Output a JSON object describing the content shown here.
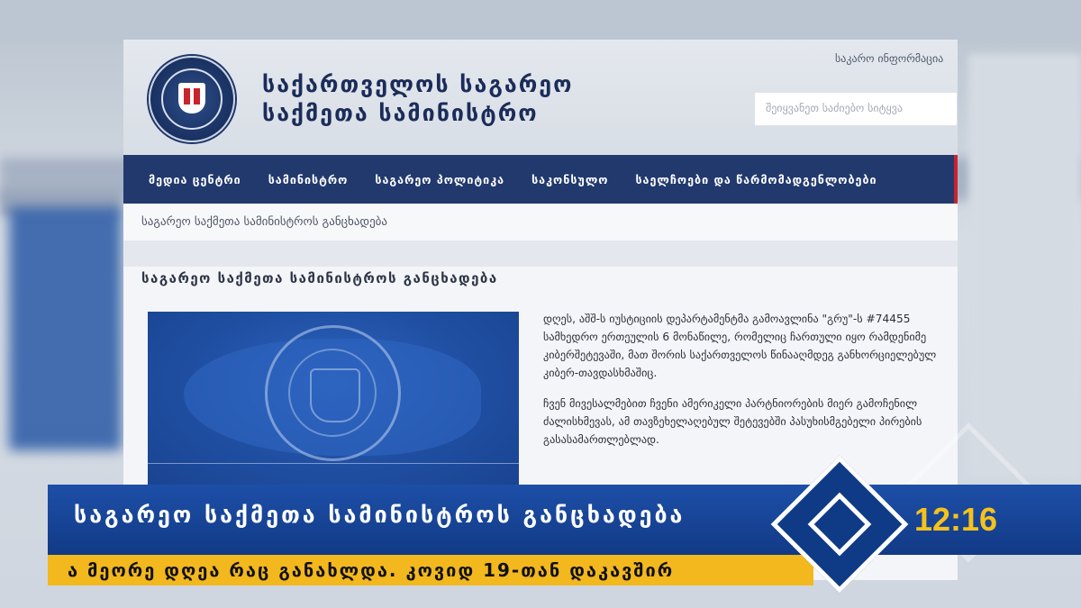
{
  "header": {
    "ministry_line1": "საქართველოს საგარეო",
    "ministry_line2": "საქმეთა სამინისტრო",
    "top_link": "საკარო ინფორმაცია",
    "search_placeholder": "შეიყვანეთ საძიებო სიტყვა"
  },
  "nav": {
    "items": [
      {
        "label": "მედია ცენტრი"
      },
      {
        "label": "სამინისტრო"
      },
      {
        "label": "საგარეო პოლიტიკა"
      },
      {
        "label": "საკონსულო"
      },
      {
        "label": "საელჩოები და წარმომადგენლობები"
      }
    ]
  },
  "breadcrumb": "საგარეო საქმეთა სამინისტროს განცხადება",
  "content": {
    "title": "საგარეო საქმეთა სამინისტროს განცხადება",
    "paragraph1": "დღეს, აშშ-ს იუსტიციის დეპარტამენტმა  გამოავლინა \"გრუ\"-ს #74455 სამხედრო ერთეულის 6 მონაწილე, რომელიც ჩართული იყო რამდენიმე კიბერშეტევაში, მათ შორის საქართველოს წინააღმდეგ განხორციელებულ კიბერ-თავდასხმაშიც.",
    "paragraph2": "ჩვენ მივესალმებით ჩვენი ამერიკელი პარტნიორების მიერ გამოჩენილ ძალისხმევას, ამ თავზეხელაღებულ შეტევებში პასუხისმგებელი პირების გასასამართლებლად."
  },
  "broadcast": {
    "headline": "საგარეო საქმეთა სამინისტროს განცხადება",
    "subline": "ა მეორე დღეა რაც განახლდა. კოვიდ 19-თან დაკავშირ",
    "clock": "12:16"
  },
  "colors": {
    "nav_bg": "#22396e",
    "ticker_blue": "#1d4fa8",
    "ticker_yellow": "#f2b81d",
    "clock_yellow": "#f6c21b"
  }
}
